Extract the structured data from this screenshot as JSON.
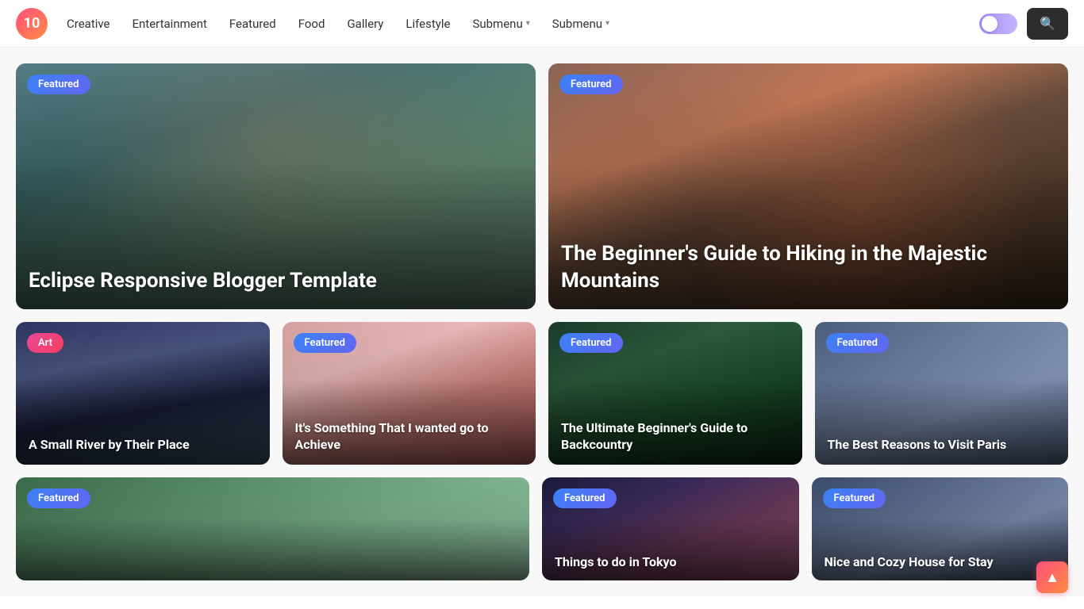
{
  "logo": {
    "text": "10"
  },
  "nav": {
    "items": [
      {
        "label": "Creative",
        "hasSubmenu": false
      },
      {
        "label": "Entertainment",
        "hasSubmenu": false
      },
      {
        "label": "Featured",
        "hasSubmenu": false
      },
      {
        "label": "Food",
        "hasSubmenu": false
      },
      {
        "label": "Gallery",
        "hasSubmenu": false
      },
      {
        "label": "Lifestyle",
        "hasSubmenu": false
      },
      {
        "label": "Submenu",
        "hasSubmenu": true
      },
      {
        "label": "Submenu",
        "hasSubmenu": true
      }
    ]
  },
  "cards": {
    "large": [
      {
        "badge": "Featured",
        "badgeType": "featured",
        "title": "Eclipse Responsive Blogger Template",
        "bgClass": "bg-hiker"
      },
      {
        "badge": "Featured",
        "badgeType": "featured",
        "title": "The Beginner's Guide to Hiking in the Majestic Mountains",
        "bgClass": "bg-camping"
      }
    ],
    "medium": [
      {
        "badge": "Art",
        "badgeType": "art",
        "title": "A Small River by Their Place",
        "bgClass": "bg-river"
      },
      {
        "badge": "Featured",
        "badgeType": "featured",
        "title": "It's Something That I wanted go to Achieve",
        "bgClass": "bg-sunglasses"
      },
      {
        "badge": "Featured",
        "badgeType": "featured",
        "title": "The Ultimate Beginner's Guide to Backcountry",
        "bgClass": "bg-backcountry"
      },
      {
        "badge": "Featured",
        "badgeType": "featured",
        "title": "The Best Reasons to Visit Paris",
        "bgClass": "bg-paris"
      }
    ],
    "bottom": [
      {
        "badge": "Featured",
        "badgeType": "featured",
        "title": "",
        "bgClass": "bg-garden"
      },
      {
        "badge": "Featured",
        "badgeType": "featured",
        "title": "Things to do in Tokyo",
        "bgClass": "bg-tokyo"
      },
      {
        "badge": "Featured",
        "badgeType": "featured",
        "title": "Nice and Cozy House for Stay",
        "bgClass": "bg-house"
      }
    ]
  },
  "scrollBtn": {
    "icon": "▲"
  }
}
